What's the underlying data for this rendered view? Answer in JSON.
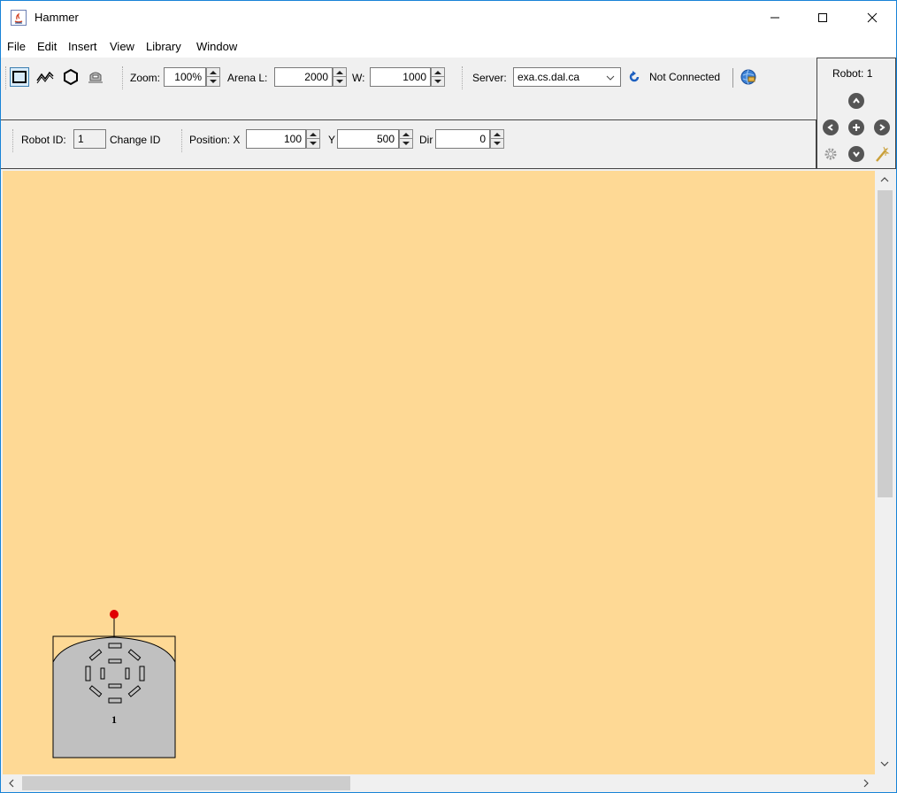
{
  "window": {
    "title": "Hammer"
  },
  "menu": [
    "File",
    "Edit",
    "Insert",
    "View",
    "Library",
    "Window"
  ],
  "toolbar": {
    "zoom_label": "Zoom:",
    "zoom_value": "100%",
    "arena_l_label": "Arena L:",
    "arena_l_value": "2000",
    "arena_w_label": "W:",
    "arena_w_value": "1000",
    "server_label": "Server:",
    "server_value": "exa.cs.dal.ca",
    "connection_status": "Not Connected"
  },
  "robot_bar": {
    "robot_id_label": "Robot ID:",
    "robot_id_value": "1",
    "change_id_label": "Change ID",
    "position_label": "Position: X",
    "x_value": "100",
    "y_label": "Y",
    "y_value": "500",
    "dir_label": "Dir",
    "dir_value": "0"
  },
  "robot_panel": {
    "title": "Robot: 1"
  },
  "arena": {
    "robot_label": "1",
    "background": "#fed995",
    "robot_body": "#c0c0c0",
    "sensor_dot": "#e00000"
  },
  "icons": [
    "java-app-icon",
    "minimize-icon",
    "maximize-icon",
    "close-icon",
    "select-rect-icon",
    "polyline-icon",
    "polygon-icon",
    "robot-tool-icon",
    "refresh-icon",
    "connect-globe-icon",
    "nav-up-icon",
    "nav-left-icon",
    "nav-add-icon",
    "nav-right-icon",
    "settings-gear-icon",
    "nav-down-icon",
    "wand-icon"
  ]
}
